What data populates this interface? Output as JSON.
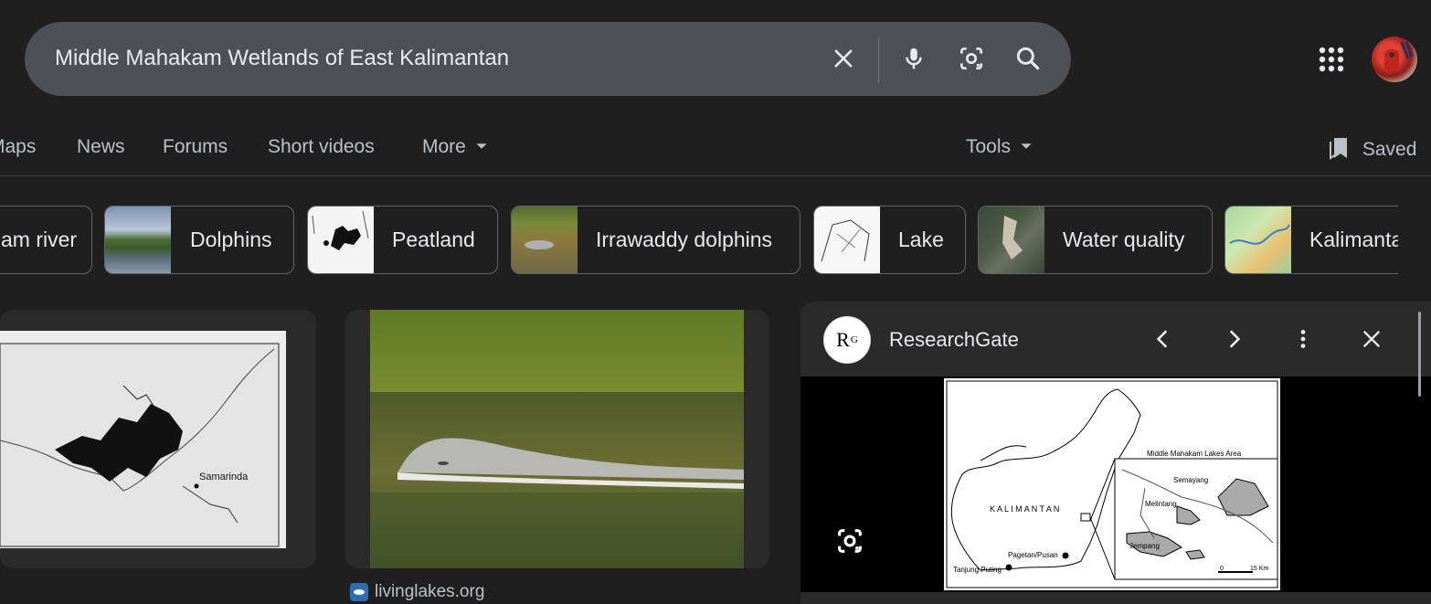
{
  "search": {
    "query": "Middle Mahakam Wetlands of East Kalimantan",
    "icons": [
      "close-icon",
      "microphone-icon",
      "lens-icon",
      "search-icon"
    ]
  },
  "header": {
    "apps_icon": "apps-grid-icon",
    "avatar": "account-avatar"
  },
  "tabs": [
    {
      "label": "Maps"
    },
    {
      "label": "News"
    },
    {
      "label": "Forums"
    },
    {
      "label": "Short videos"
    },
    {
      "label": "More"
    }
  ],
  "tools_label": "Tools",
  "saved_label": "Saved",
  "chips": [
    {
      "label": "am river"
    },
    {
      "label": "Dolphins"
    },
    {
      "label": "Peatland"
    },
    {
      "label": "Irrawaddy dolphins"
    },
    {
      "label": "Lake"
    },
    {
      "label": "Water quality"
    },
    {
      "label": "Kalimanta"
    }
  ],
  "results": {
    "map_label": "Samarinda",
    "source": "livinglakes.org"
  },
  "panel": {
    "logo": "R",
    "logo_sup": "G",
    "site": "ResearchGate",
    "map": {
      "area_label": "Middle Mahakam Lakes Area",
      "kalimantan": "K A L I M A N T A N",
      "semayang": "Semayang",
      "melintang": "Melintang",
      "jempang": "Jempang",
      "pagetan": "Pagetan/Pusan",
      "tanjung": "Tanjung Puting",
      "scale_zero": "0",
      "scale_km": "15 Km"
    }
  },
  "colors": {
    "background": "#1f1f1f",
    "searchbar": "#4d5156",
    "card": "#2a2a2a"
  }
}
